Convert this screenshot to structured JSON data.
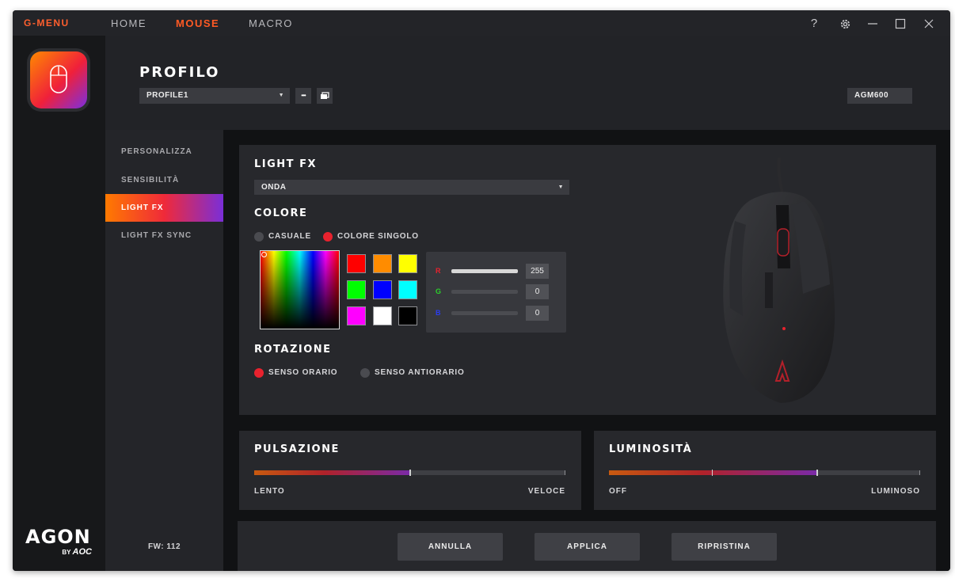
{
  "titlebar": {
    "brand": "G-MENU",
    "nav": [
      "HOME",
      "MOUSE",
      "MACRO"
    ],
    "active_nav": "MOUSE",
    "help_glyph": "?"
  },
  "brand_logo": {
    "word": "AGON",
    "by": "BY",
    "maker": "AOC"
  },
  "header": {
    "title": "PROFILO",
    "profile_value": "PROFILE1",
    "more_glyph": "•••",
    "model": "AGM600"
  },
  "side_menu": {
    "items": [
      "PERSONALIZZA",
      "SENSIBILITÀ",
      "LIGHT FX",
      "LIGHT FX SYNC"
    ],
    "active": "LIGHT FX",
    "fw": "FW: 112"
  },
  "light_fx": {
    "title": "LIGHT FX",
    "effect_value": "ONDA",
    "color_title": "COLORE",
    "color_options": [
      "CASUALE",
      "COLORE SINGOLO"
    ],
    "color_selected": "COLORE SINGOLO",
    "swatches": [
      "#ff0000",
      "#ff8c00",
      "#ffff00",
      "#00ff00",
      "#0000ff",
      "#00ffff",
      "#ff00ff",
      "#ffffff",
      "#000000"
    ],
    "rgb": {
      "r_label": "R",
      "g_label": "G",
      "b_label": "B",
      "r": "255",
      "g": "0",
      "b": "0",
      "r_color": "#e8222e",
      "g_color": "#2bd12b",
      "b_color": "#2a3cf0"
    },
    "rotation_title": "ROTAZIONE",
    "rotation_options": [
      "SENSO ORARIO",
      "SENSO ANTIORARIO"
    ],
    "rotation_selected": "SENSO ORARIO"
  },
  "pulsazione": {
    "title": "PULSAZIONE",
    "min_label": "LENTO",
    "max_label": "VELOCE",
    "level": 0.5
  },
  "luminosita": {
    "title": "LUMINOSITÀ",
    "min_label": "OFF",
    "max_label": "LUMINOSO",
    "level": 0.67
  },
  "footer": {
    "cancel": "ANNULLA",
    "apply": "APPLICA",
    "reset": "RIPRISTINA"
  },
  "colors": {
    "accent_orange": "#ff5a24",
    "accent_red": "#e8222e",
    "accent_purple": "#7a2ed8"
  }
}
